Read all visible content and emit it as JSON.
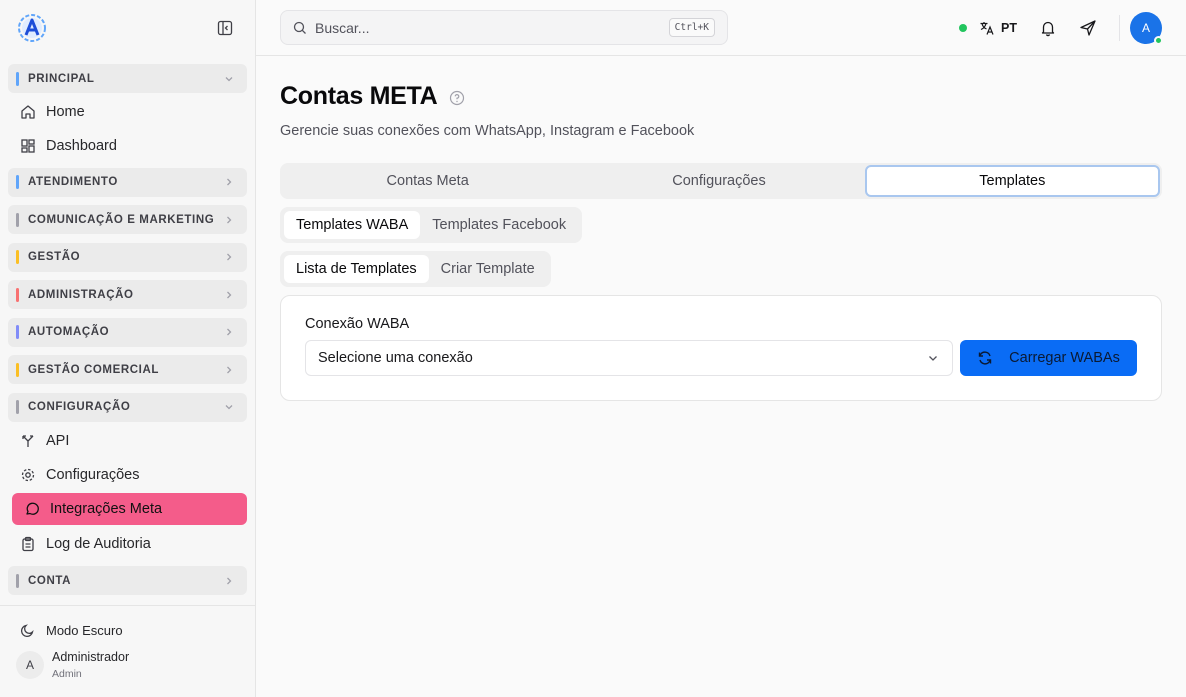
{
  "sidebar": {
    "groups": {
      "principal": {
        "label": "PRINCIPAL",
        "color": "#60a5fa"
      },
      "atendimento": {
        "label": "ATENDIMENTO",
        "color": "#60a5fa"
      },
      "comunicacao": {
        "label": "COMUNICAÇÃO E MARKETING",
        "color": "#a1a1aa"
      },
      "gestao": {
        "label": "GESTÃO",
        "color": "#fbbf24"
      },
      "administracao": {
        "label": "ADMINISTRAÇÃO",
        "color": "#f87171"
      },
      "automacao": {
        "label": "AUTOMAÇÃO",
        "color": "#818cf8"
      },
      "gestao_comercial": {
        "label": "GESTÃO COMERCIAL",
        "color": "#fbbf24"
      },
      "configuracao": {
        "label": "CONFIGURAÇÃO",
        "color": "#a1a1aa"
      },
      "conta": {
        "label": "CONTA",
        "color": "#a1a1aa"
      }
    },
    "items": {
      "home": "Home",
      "dashboard": "Dashboard",
      "api": "API",
      "configuracoes": "Configurações",
      "integracoes_meta": "Integrações Meta",
      "log_auditoria": "Log de Auditoria"
    },
    "dark_mode": "Modo Escuro",
    "user": {
      "initial": "A",
      "name": "Administrador",
      "role": "Admin"
    }
  },
  "header": {
    "search_placeholder": "Buscar...",
    "shortcut": "Ctrl+K",
    "language": "PT",
    "avatar_initial": "A"
  },
  "main": {
    "title": "Contas META",
    "subtitle": "Gerencie suas conexões com WhatsApp, Instagram e Facebook",
    "tabs": [
      "Contas Meta",
      "Configurações",
      "Templates"
    ],
    "subtabs": [
      "Templates WABA",
      "Templates Facebook"
    ],
    "subsubtabs": [
      "Lista de Templates",
      "Criar Template"
    ],
    "card": {
      "field_label": "Conexão WABA",
      "select_value": "Selecione uma conexão",
      "button": "Carregar WABAs"
    }
  },
  "colors": {
    "accent": "#0a6cf5",
    "active_item": "#f45c8a",
    "online": "#22c55e"
  }
}
